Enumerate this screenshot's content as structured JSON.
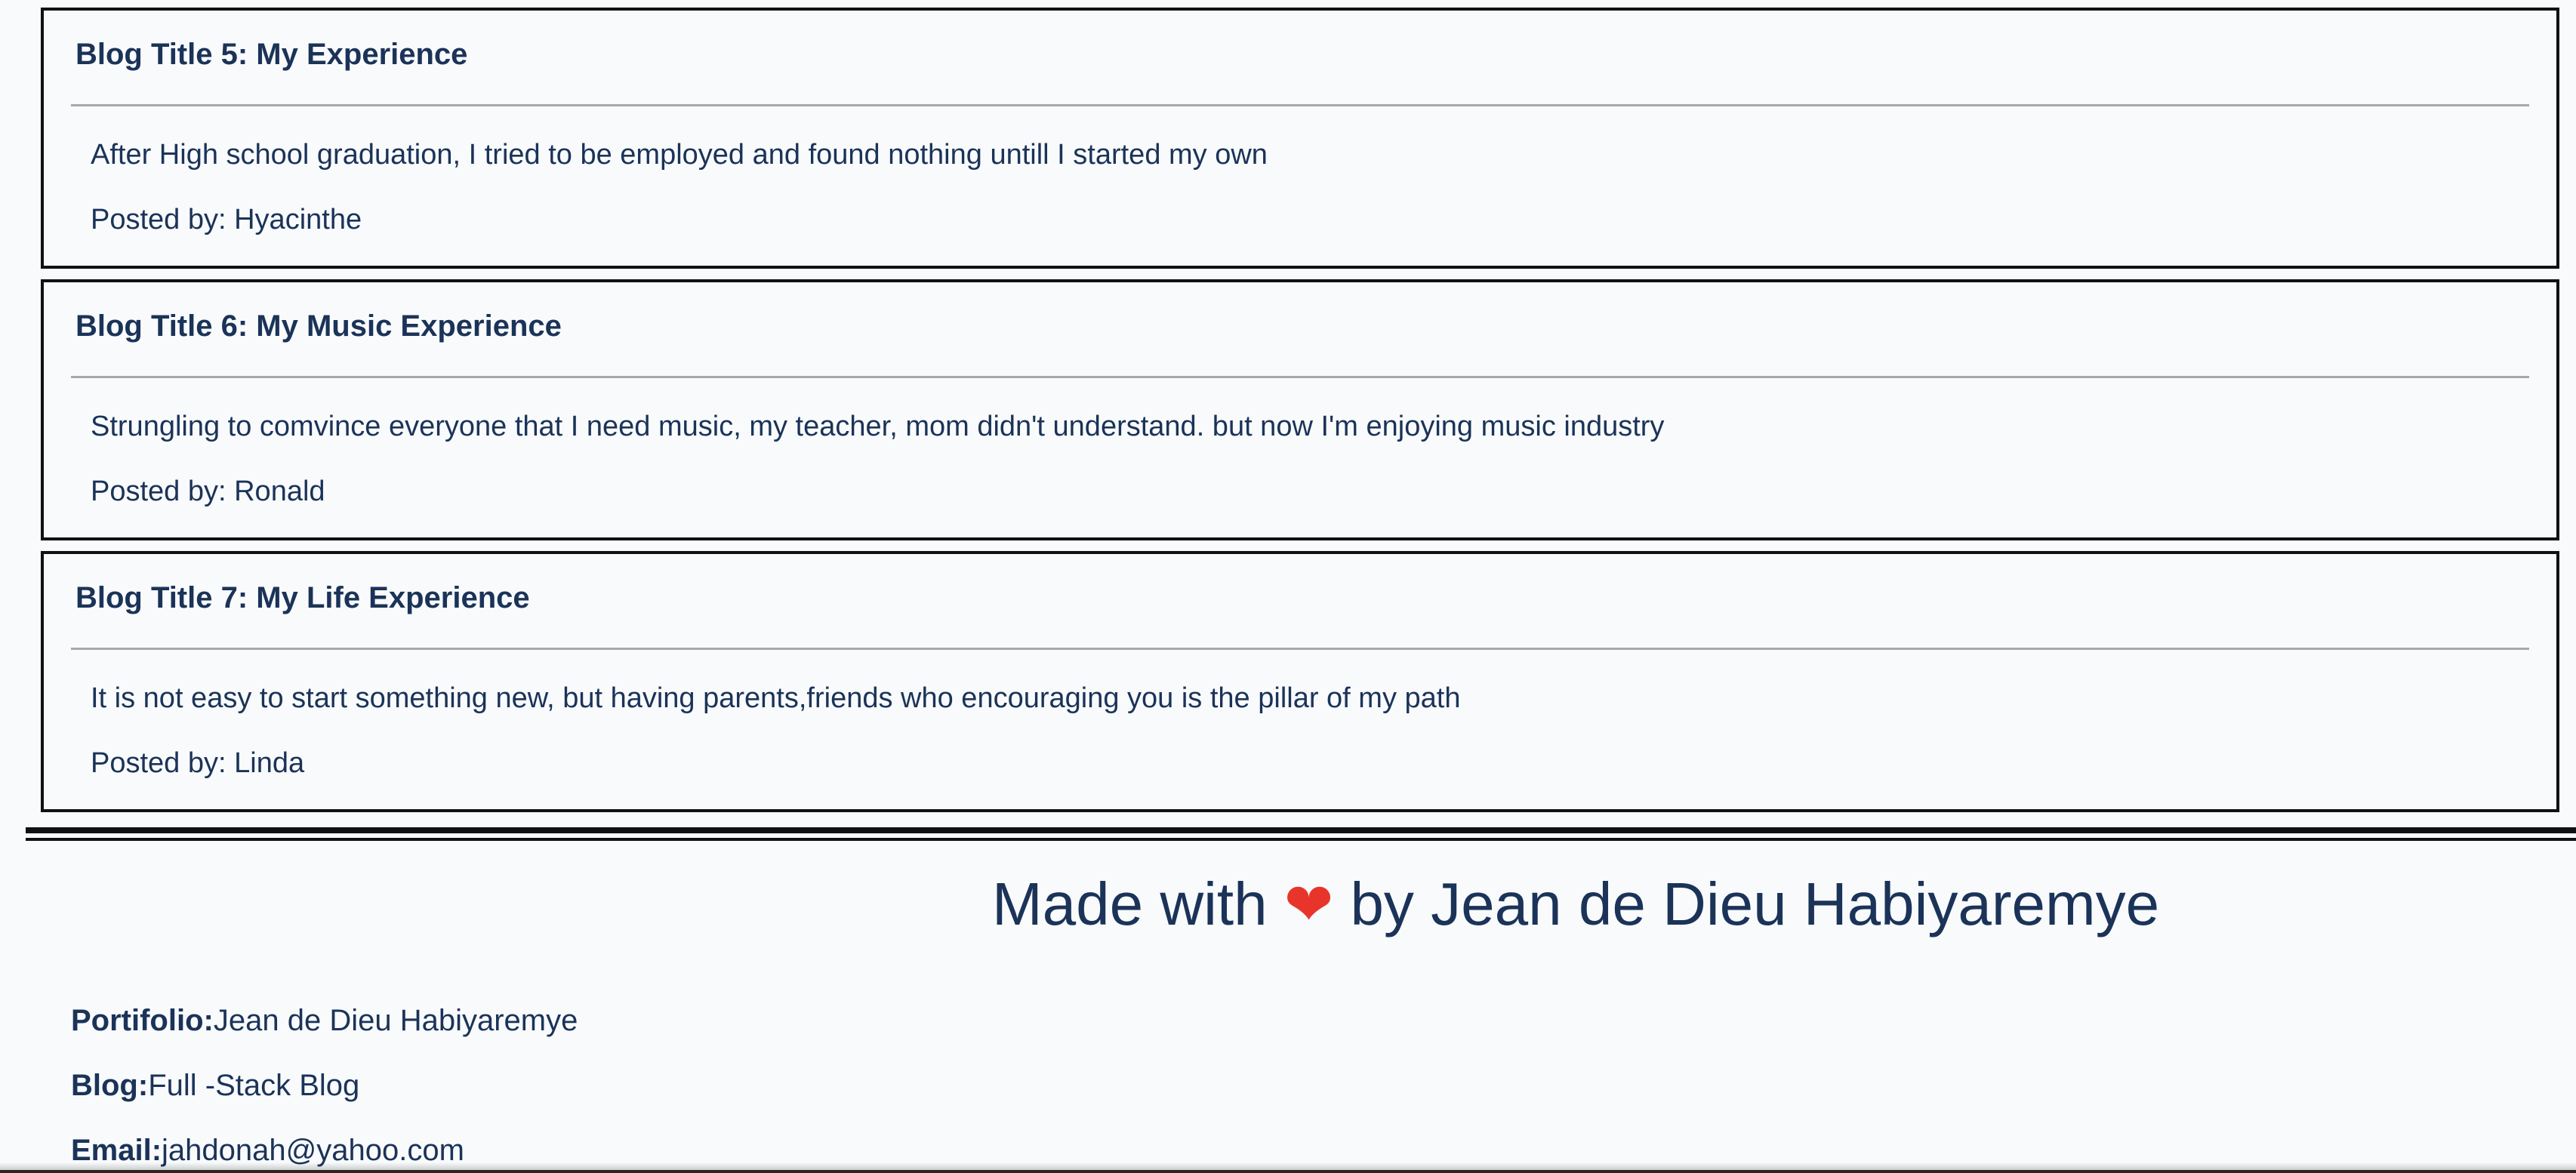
{
  "posts": [
    {
      "title": "Blog Title 5: My Experience",
      "body": "After High school graduation, I tried to be employed and found nothing untill I started my own",
      "author": "Posted by: Hyacinthe"
    },
    {
      "title": "Blog Title 6: My Music Experience",
      "body": "Strungling to comvince everyone that I need music, my teacher, mom didn't understand. but now I'm enjoying music industry",
      "author": "Posted by: Ronald"
    },
    {
      "title": "Blog Title 7: My Life Experience",
      "body": "It is not easy to start something new, but having parents,friends who encouraging you is the pillar of my path",
      "author": "Posted by: Linda"
    }
  ],
  "footer": {
    "made_with_prefix": "Made with",
    "heart_icon": "heart-icon",
    "heart_glyph": "❤",
    "made_with_suffix": "by Jean de Dieu Habiyaremye",
    "heart_color": "#e8352b",
    "portfolio_label": "Portifolio:",
    "portfolio_value": "Jean de Dieu Habiyaremye",
    "blog_label": "Blog:",
    "blog_value": "Full -Stack Blog",
    "email_label": "Email:",
    "email_value": "jahdonah@yahoo.com"
  },
  "colors": {
    "text": "#1b3358",
    "background": "#f8fafc",
    "border": "#111111",
    "divider": "#a8a8a8"
  }
}
